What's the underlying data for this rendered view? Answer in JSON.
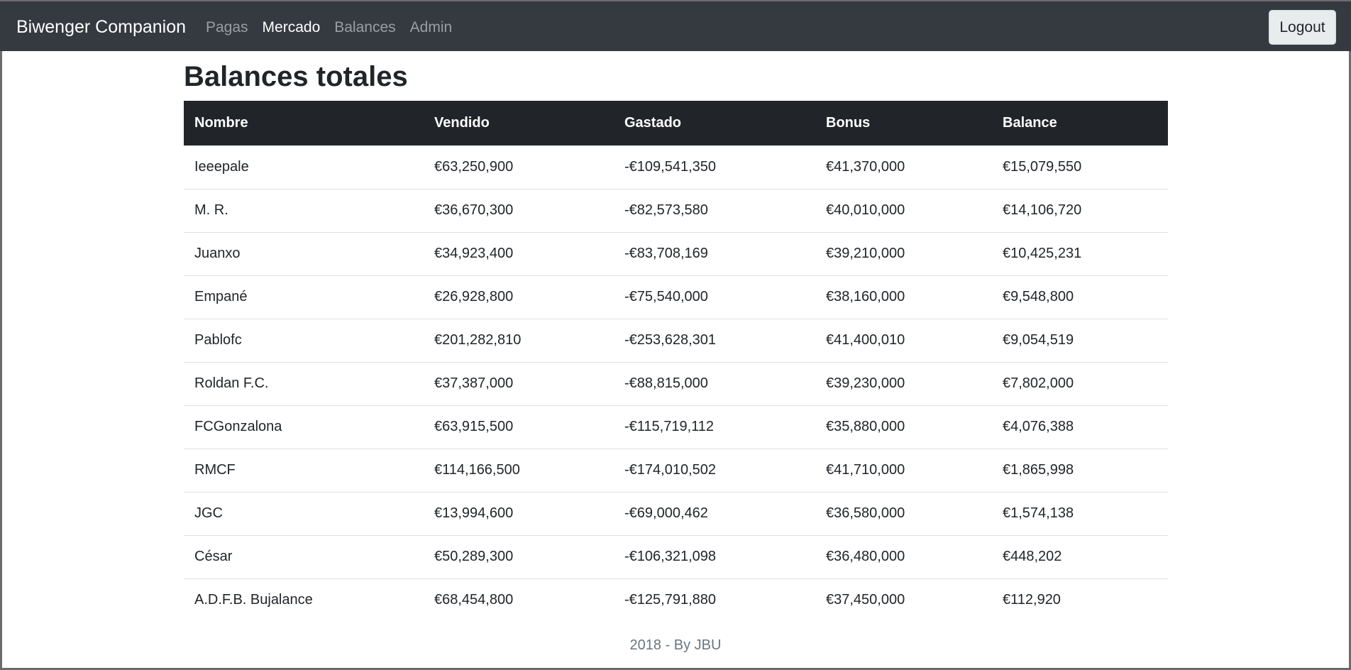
{
  "navbar": {
    "brand": "Biwenger Companion",
    "links": [
      {
        "label": "Pagas",
        "active": false
      },
      {
        "label": "Mercado",
        "active": true
      },
      {
        "label": "Balances",
        "active": false
      },
      {
        "label": "Admin",
        "active": false
      }
    ],
    "logout_label": "Logout"
  },
  "main": {
    "title": "Balances totales",
    "table": {
      "columns": [
        "Nombre",
        "Vendido",
        "Gastado",
        "Bonus",
        "Balance"
      ],
      "rows": [
        [
          "Ieeepale",
          "€63,250,900",
          "-€109,541,350",
          "€41,370,000",
          "€15,079,550"
        ],
        [
          "M. R.",
          "€36,670,300",
          "-€82,573,580",
          "€40,010,000",
          "€14,106,720"
        ],
        [
          "Juanxo",
          "€34,923,400",
          "-€83,708,169",
          "€39,210,000",
          "€10,425,231"
        ],
        [
          "Empané",
          "€26,928,800",
          "-€75,540,000",
          "€38,160,000",
          "€9,548,800"
        ],
        [
          "Pablofc",
          "€201,282,810",
          "-€253,628,301",
          "€41,400,010",
          "€9,054,519"
        ],
        [
          "Roldan F.C.",
          "€37,387,000",
          "-€88,815,000",
          "€39,230,000",
          "€7,802,000"
        ],
        [
          "FCGonzalona",
          "€63,915,500",
          "-€115,719,112",
          "€35,880,000",
          "€4,076,388"
        ],
        [
          "RMCF",
          "€114,166,500",
          "-€174,010,502",
          "€41,710,000",
          "€1,865,998"
        ],
        [
          "JGC",
          "€13,994,600",
          "-€69,000,462",
          "€36,580,000",
          "€1,574,138"
        ],
        [
          "César",
          "€50,289,300",
          "-€106,321,098",
          "€36,480,000",
          "€448,202"
        ],
        [
          "A.D.F.B. Bujalance",
          "€68,454,800",
          "-€125,791,880",
          "€37,450,000",
          "€112,920"
        ]
      ]
    }
  },
  "footer": {
    "text": "2018 - By JBU"
  }
}
